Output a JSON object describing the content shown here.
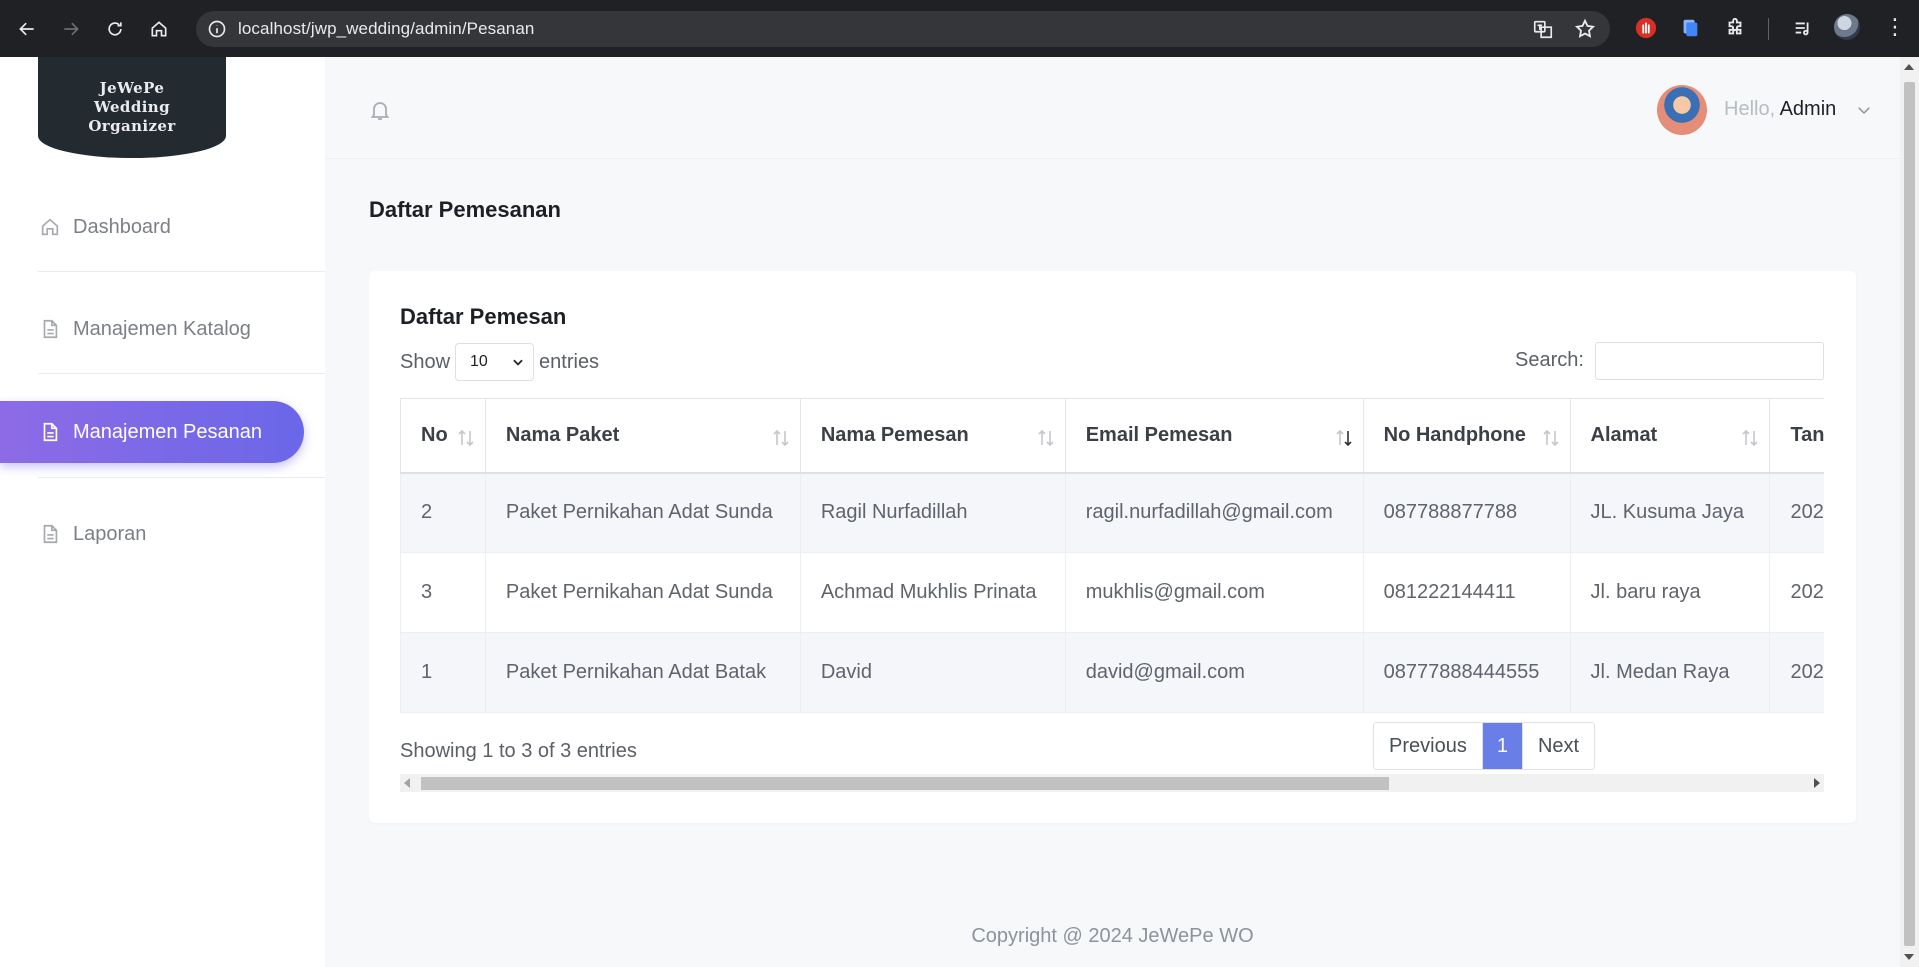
{
  "browser": {
    "url": "localhost/jwp_wedding/admin/Pesanan"
  },
  "sidebar": {
    "logo_lines": [
      "JeWePe",
      "Wedding",
      "Organizer"
    ],
    "items": [
      {
        "label": "Dashboard",
        "icon": "home-icon"
      },
      {
        "label": "Manajemen Katalog",
        "icon": "document-icon"
      },
      {
        "label": "Manajemen Pesanan",
        "icon": "document-icon",
        "active": true
      },
      {
        "label": "Laporan",
        "icon": "document-icon"
      }
    ]
  },
  "header": {
    "greeting": "Hello,",
    "user_name": "Admin"
  },
  "page": {
    "title": "Daftar Pemesanan"
  },
  "card": {
    "title": "Daftar Pemesan",
    "show_label": "Show",
    "page_size": "10",
    "entries_label": "entries",
    "search_label": "Search:"
  },
  "table": {
    "columns": [
      "No",
      "Nama Paket",
      "Nama Pemesan",
      "Email Pemesan",
      "No Handphone",
      "Alamat",
      "Tan"
    ],
    "rows": [
      [
        "2",
        "Paket Pernikahan Adat Sunda",
        "Ragil Nurfadillah",
        "ragil.nurfadillah@gmail.com",
        "087788877788",
        "JL. Kusuma Jaya",
        "202"
      ],
      [
        "3",
        "Paket Pernikahan Adat Sunda",
        "Achmad Mukhlis Prinata",
        "mukhlis@gmail.com",
        "081222144411",
        "Jl. baru raya",
        "202"
      ],
      [
        "1",
        "Paket Pernikahan Adat Batak",
        "David",
        "david@gmail.com",
        "08777888444555",
        "Jl. Medan Raya",
        "202"
      ]
    ],
    "sorted_column": "Email Pemesan"
  },
  "pagination": {
    "info": "Showing 1 to 3 of 3 entries",
    "previous": "Previous",
    "current": "1",
    "next": "Next"
  },
  "footer": {
    "text": "Copyright @ 2024 JeWePe WO"
  },
  "colors": {
    "accent_gradient_start": "#8e6be6",
    "accent_gradient_end": "#6a67e8",
    "pagination_active": "#6a7ee8"
  }
}
